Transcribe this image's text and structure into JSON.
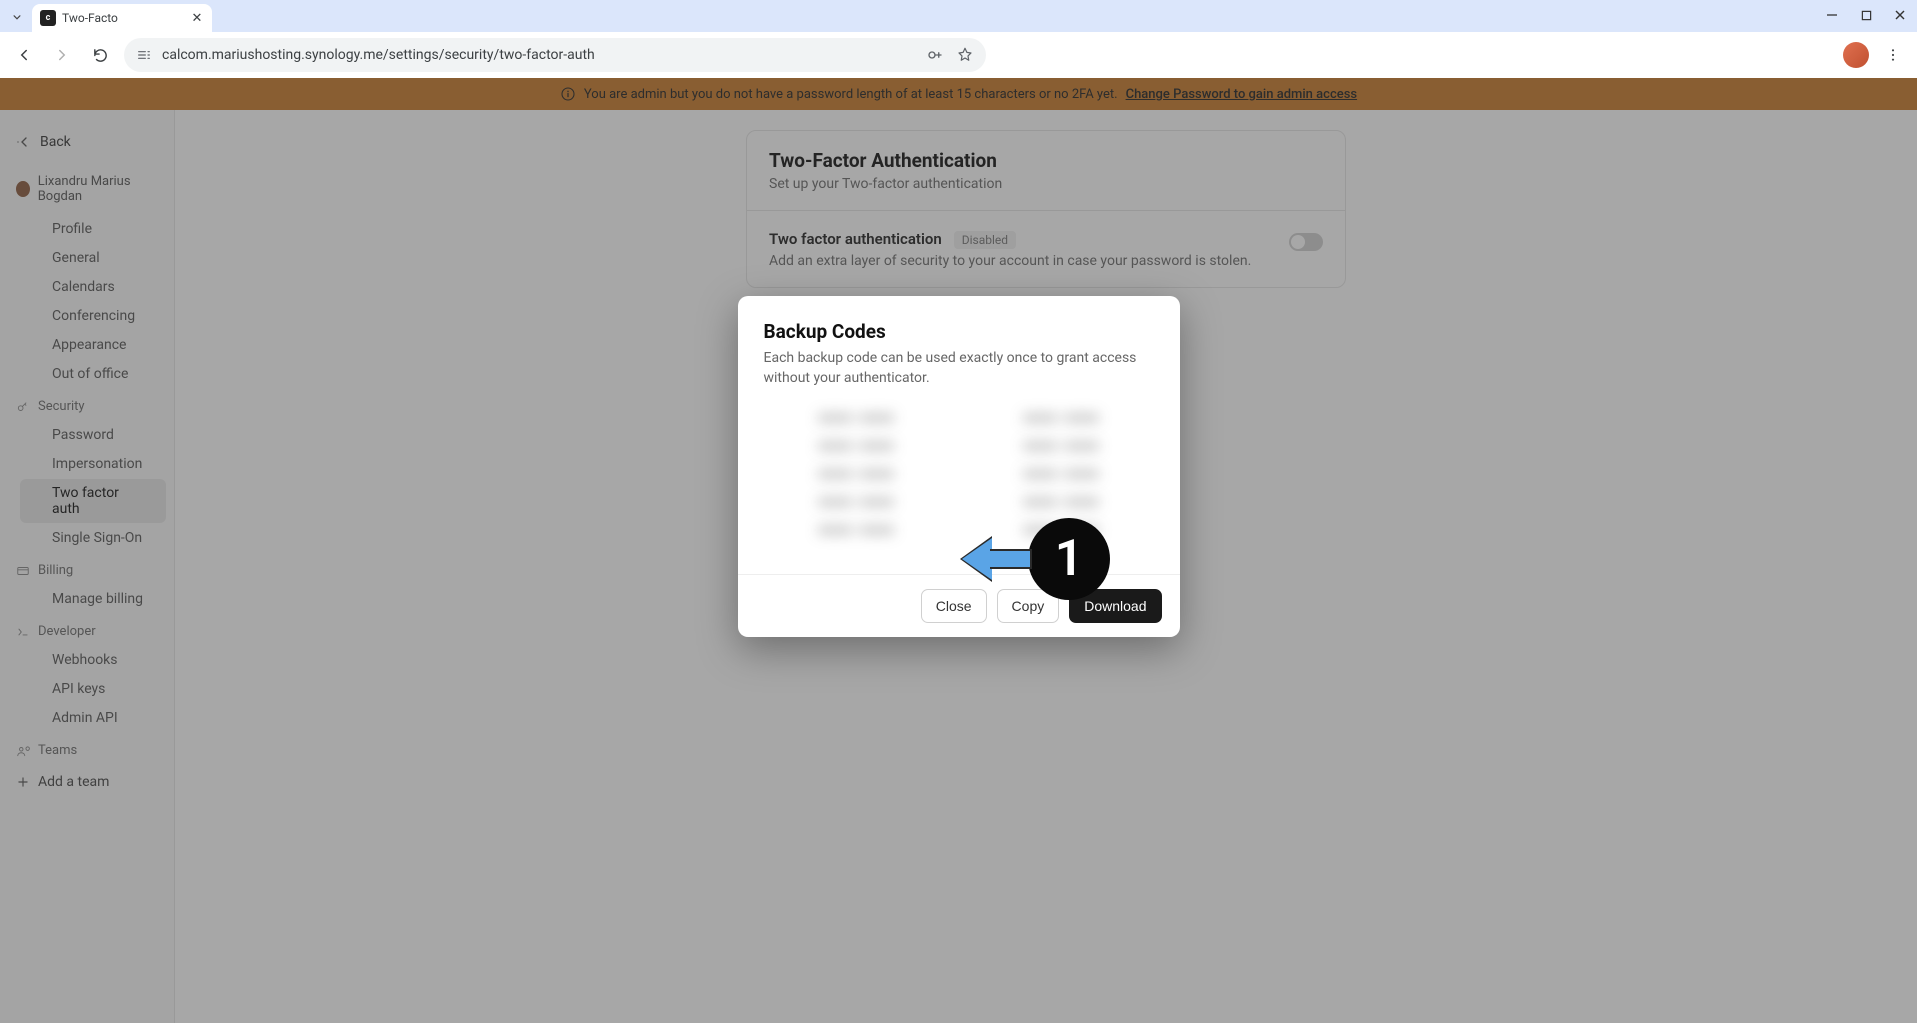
{
  "browser": {
    "tab_title": "Two-Facto",
    "url": "calcom.mariushosting.synology.me/settings/security/two-factor-auth"
  },
  "banner": {
    "text": "You are admin but you do not have a password length of at least 15 characters or no 2FA yet.",
    "link_text": "Change Password to gain admin access"
  },
  "sidebar": {
    "back_label": "Back",
    "user_name": "Lixandru Marius Bogdan",
    "groups": [
      {
        "head": null,
        "items": [
          "Profile",
          "General",
          "Calendars",
          "Conferencing",
          "Appearance",
          "Out of office"
        ]
      },
      {
        "head": "Security",
        "items": [
          "Password",
          "Impersonation",
          "Two factor auth",
          "Single Sign-On"
        ],
        "active": "Two factor auth"
      },
      {
        "head": "Billing",
        "items": [
          "Manage billing"
        ]
      },
      {
        "head": "Developer",
        "items": [
          "Webhooks",
          "API keys",
          "Admin API"
        ]
      },
      {
        "head": "Teams",
        "items": []
      }
    ],
    "add_team_label": "Add a team"
  },
  "main": {
    "title": "Two-Factor Authentication",
    "subtitle": "Set up your Two-factor authentication",
    "setting_title": "Two factor authentication",
    "setting_badge": "Disabled",
    "setting_desc": "Add an extra layer of security to your account in case your password is stolen."
  },
  "modal": {
    "title": "Backup Codes",
    "desc": "Each backup code can be used exactly once to grant access without your authenticator.",
    "codes": [
      "xxxx-xxxx",
      "xxxx-xxxx",
      "xxxx-xxxx",
      "xxxx-xxxx",
      "xxxx-xxxx",
      "xxxx-xxxx",
      "xxxx-xxxx",
      "xxxx-xxxx",
      "xxxx-xxxx",
      "xxxx-xxxx"
    ],
    "close_label": "Close",
    "copy_label": "Copy",
    "download_label": "Download"
  },
  "annotation": {
    "number": "1"
  }
}
